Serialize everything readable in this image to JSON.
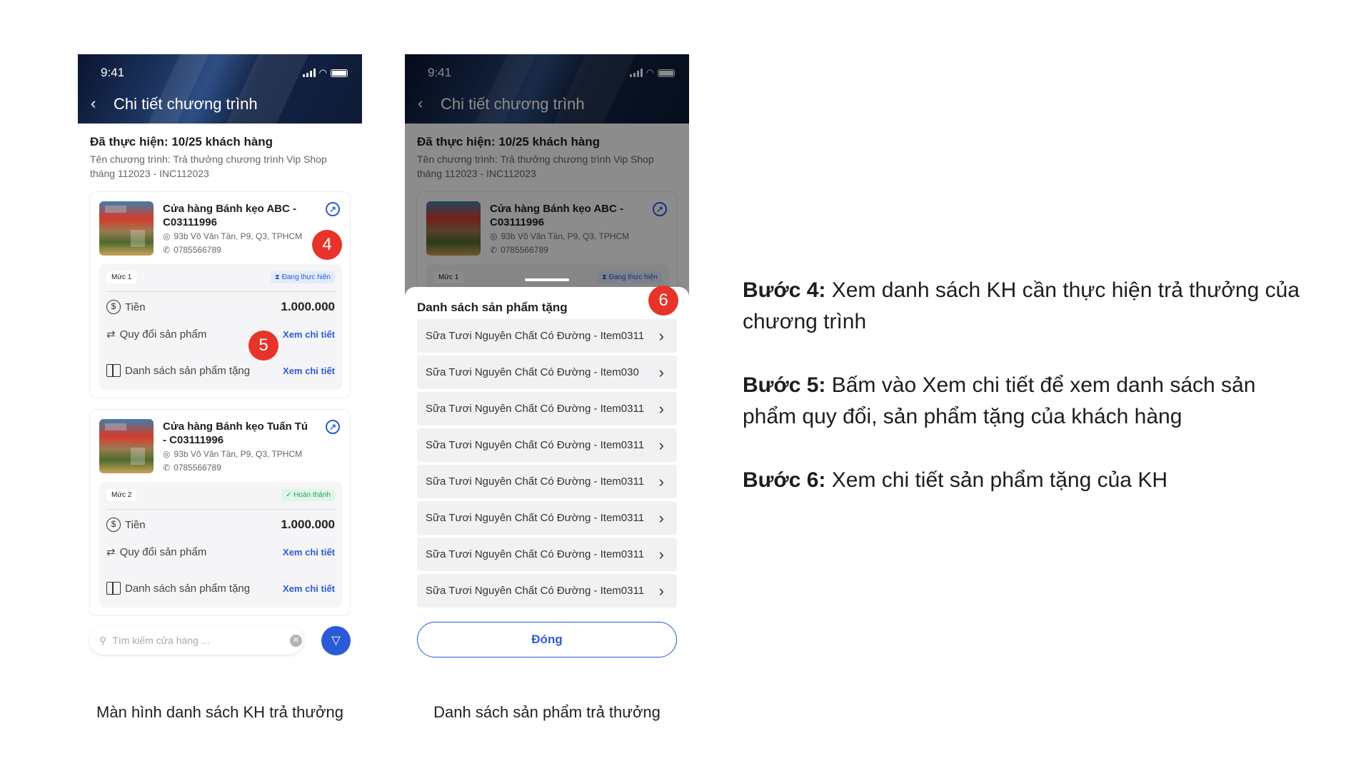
{
  "status_bar": {
    "time": "9:41"
  },
  "screen1": {
    "header_title": "Chi tiết chương trình",
    "progress": "Đã thực hiện: 10/25 khách hàng",
    "program_name": "Tên chương trình: Trả thưởng chương trình Vip Shop tháng 112023 - INC112023",
    "stores": [
      {
        "name": "Cửa hàng Bánh kẹo ABC - C03111996",
        "address": "93b Võ Văn Tần, P9, Q3, TPHCM",
        "phone": "0785566789",
        "level": "Mức 1",
        "status": "Đang thực hiện",
        "money_label": "Tiền",
        "amount": "1.000.000",
        "swap_label": "Quy đổi sản phẩm",
        "gift_label": "Danh sách sản phẩm tặng",
        "detail_link": "Xem chi tiết"
      },
      {
        "name": "Cửa hàng Bánh kẹo Tuấn Tú - C03111996",
        "address": "93b Võ Văn Tần, P9, Q3, TPHCM",
        "phone": "0785566789",
        "level": "Mức 2",
        "status": "Hoàn thành",
        "money_label": "Tiền",
        "amount": "1.000.000",
        "swap_label": "Quy đổi sản phẩm",
        "gift_label": "Danh sách sản phẩm tặng",
        "detail_link": "Xem chi tiết"
      }
    ],
    "search_placeholder": "Tìm kiếm cửa hàng ...",
    "caption": "Màn hình danh sách KH trả thưởng"
  },
  "screen2": {
    "sheet_title": "Danh sách sản phẩm tặng",
    "items": [
      "Sữa Tươi Nguyên Chất Có Đường - Item0311",
      "Sữa Tươi Nguyên Chất Có Đường - Item030",
      "Sữa Tươi Nguyên Chất Có Đường - Item0311",
      "Sữa Tươi Nguyên Chất Có Đường - Item0311",
      "Sữa Tươi Nguyên Chất Có Đường - Item0311",
      "Sữa Tươi Nguyên Chất Có Đường - Item0311",
      "Sữa Tươi Nguyên Chất Có Đường - Item0311",
      "Sữa Tươi Nguyên Chất Có Đường - Item0311"
    ],
    "close_label": "Đóng",
    "caption": "Danh sách sản phẩm trả thưởng"
  },
  "badges": {
    "b4": "4",
    "b5": "5",
    "b6": "6"
  },
  "steps": [
    {
      "label": "Bước 4:",
      "text": " Xem danh sách KH cần thực hiện trả thưởng của chương trình"
    },
    {
      "label": "Bước 5:",
      "text": " Bấm vào Xem chi tiết để xem danh sách sản phẩm quy đổi, sản phẩm tặng của khách hàng"
    },
    {
      "label": "Bước 6:",
      "text": " Xem chi tiết sản phẩm tặng của KH"
    }
  ],
  "icons": {
    "back": "chevron-left-icon",
    "external": "external-link-icon",
    "location": "location-pin-icon",
    "phone": "phone-icon",
    "money": "dollar-coin-icon",
    "swap": "swap-arrows-icon",
    "gift": "gift-icon",
    "search": "search-icon",
    "filter": "filter-funnel-icon",
    "chevron": "chevron-right-icon"
  },
  "colors": {
    "accent": "#2a5bd7",
    "badge": "#e8332b",
    "done": "#22a55a"
  }
}
